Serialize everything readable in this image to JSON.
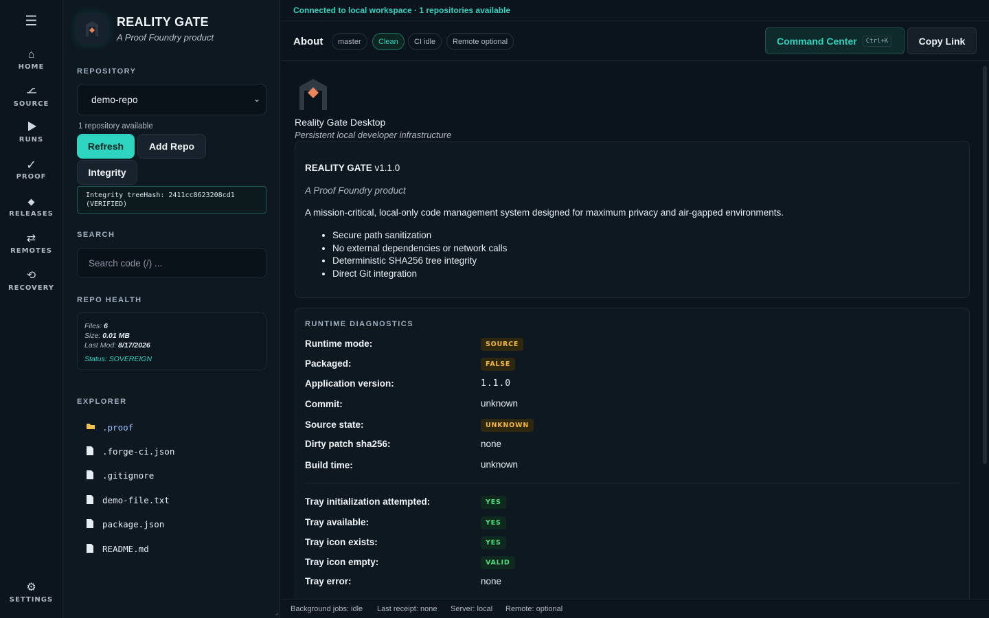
{
  "colors": {
    "accent": "#2dd4bf",
    "background": "#0b141d",
    "warning": "#f5b83d",
    "success": "#4ade80"
  },
  "rail": {
    "menu_icon": "hamburger-icon",
    "items": [
      {
        "label": "HOME",
        "icon": "home-icon"
      },
      {
        "label": "SOURCE",
        "icon": "source-icon"
      },
      {
        "label": "RUNS",
        "icon": "play-icon"
      },
      {
        "label": "PROOF",
        "icon": "check-icon"
      },
      {
        "label": "RELEASES",
        "icon": "diamond-icon"
      },
      {
        "label": "REMOTES",
        "icon": "swap-arrows-icon"
      },
      {
        "label": "RECOVERY",
        "icon": "restore-icon"
      }
    ],
    "settings_label": "SETTINGS"
  },
  "sidebar": {
    "brand_name": "REALITY GATE",
    "brand_tagline": "A Proof Foundry product",
    "repository_label": "REPOSITORY",
    "repo_selected": "demo-repo",
    "repo_count": "1 repository available",
    "refresh_label": "Refresh",
    "add_repo_label": "Add Repo",
    "integrity_label": "Integrity",
    "integrity_result": "Integrity treeHash: 2411cc8623208cd1 (VERIFIED)",
    "search_label": "SEARCH",
    "search_placeholder": "Search code (/) ...",
    "health_label": "REPO HEALTH",
    "health": {
      "files_label": "Files:",
      "files_value": "6",
      "size_label": "Size:",
      "size_value": "0.01 MB",
      "lastmod_label": "Last Mod:",
      "lastmod_value": "8/17/2026",
      "status": "Status: SOVEREIGN"
    },
    "explorer_label": "EXPLORER",
    "files": [
      {
        "name": ".proof",
        "type": "folder"
      },
      {
        "name": ".forge-ci.json",
        "type": "file"
      },
      {
        "name": ".gitignore",
        "type": "file"
      },
      {
        "name": "demo-file.txt",
        "type": "file"
      },
      {
        "name": "package.json",
        "type": "file"
      },
      {
        "name": "README.md",
        "type": "file"
      }
    ]
  },
  "main": {
    "connection_status": "Connected to local workspace · 1 repositories available",
    "title": "About",
    "pills": [
      "master",
      "Clean",
      "CI idle",
      "Remote optional"
    ],
    "command_center_label": "Command Center",
    "command_center_shortcut": "Ctrl+K",
    "copy_link_label": "Copy Link",
    "about": {
      "app_name": "Reality Gate Desktop",
      "app_subtitle": "Persistent local developer infrastructure",
      "card_title": "REALITY GATE",
      "card_version": "v1.1.0",
      "card_tagline": "A Proof Foundry product",
      "card_description": "A mission-critical, local-only code management system designed for maximum privacy and air-gapped environments.",
      "features": [
        "Secure path sanitization",
        "No external dependencies or network calls",
        "Deterministic SHA256 tree integrity",
        "Direct Git integration"
      ]
    },
    "diagnostics": {
      "title": "RUNTIME DIAGNOSTICS",
      "rows": [
        {
          "label": "Runtime mode:",
          "value": "SOURCE",
          "kind": "badge-warn"
        },
        {
          "label": "Packaged:",
          "value": "FALSE",
          "kind": "badge-warn"
        },
        {
          "label": "Application version:",
          "value": "1.1.0",
          "kind": "mono"
        },
        {
          "label": "Commit:",
          "value": "unknown",
          "kind": "text"
        },
        {
          "label": "Source state:",
          "value": "UNKNOWN",
          "kind": "badge-warn"
        },
        {
          "label": "Dirty patch sha256:",
          "value": "none",
          "kind": "text"
        },
        {
          "label": "Build time:",
          "value": "unknown",
          "kind": "text"
        },
        {
          "label": "Tray initialization attempted:",
          "value": "YES",
          "kind": "badge-ok"
        },
        {
          "label": "Tray available:",
          "value": "YES",
          "kind": "badge-ok"
        },
        {
          "label": "Tray icon exists:",
          "value": "YES",
          "kind": "badge-ok"
        },
        {
          "label": "Tray icon empty:",
          "value": "VALID",
          "kind": "badge-ok"
        },
        {
          "label": "Tray error:",
          "value": "none",
          "kind": "text"
        }
      ]
    },
    "status_bar": [
      "Background jobs: idle",
      "Last receipt: none",
      "Server: local",
      "Remote: optional"
    ]
  }
}
